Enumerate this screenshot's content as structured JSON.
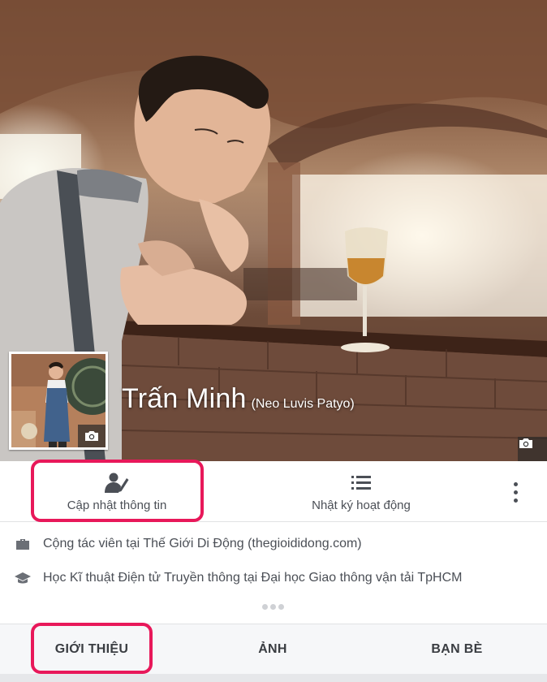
{
  "profile": {
    "name": "Trấn Minh",
    "alternate_name": "(Neo Luvis Patyo)"
  },
  "actions": {
    "update_info_label": "Cập nhật thông tin",
    "activity_log_label": "Nhật ký hoạt động"
  },
  "info": {
    "work": "Cộng tác viên tại Thế Giới Di Động (thegioididong.com)",
    "education": "Học Kĩ thuật Điện tử Truyền thông tại Đại học Giao thông vận tải TpHCM"
  },
  "tabs": {
    "intro": "GIỚI THIỆU",
    "photos": "ẢNH",
    "friends": "BẠN BÈ"
  },
  "colors": {
    "highlight": "#e8185a",
    "text": "#4b4f56",
    "tab_bg": "#f6f7f9"
  },
  "icons": {
    "cover_camera": "camera-icon",
    "avatar_camera": "camera-icon",
    "update_info": "person-edit-icon",
    "activity_log": "list-icon",
    "more": "more-vertical-icon",
    "work": "briefcase-icon",
    "education": "graduation-cap-icon"
  }
}
